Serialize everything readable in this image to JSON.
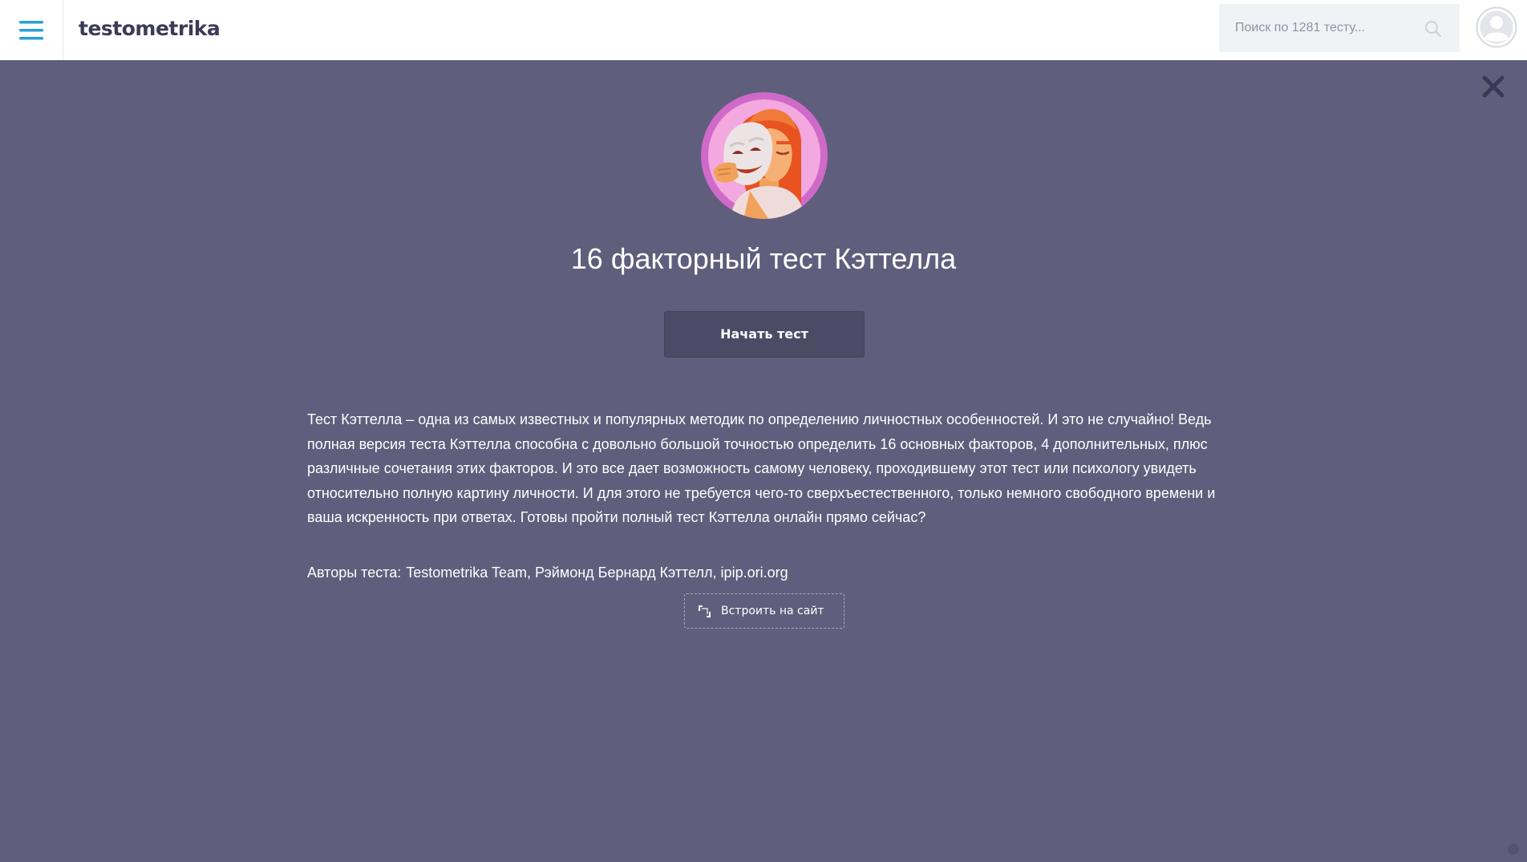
{
  "header": {
    "logo_text": "testometrika",
    "search_placeholder": "Поиск по 1281 тесту...",
    "menu_icon": "hamburger-icon",
    "avatar_icon": "user-avatar-icon"
  },
  "test": {
    "title": "16 факторный тест Кэттелла",
    "start_label": "Начать тест",
    "description": "Тест Кэттелла – одна из самых известных и популярных методик по определению личностных особенностей. И это не случайно! Ведь полная версия теста Кэттелла способна с довольно большой точностью определить 16 основных факторов, 4 дополнительных, плюс различные сочетания этих факторов. И это все дает возможность самому человеку, проходившему этот тест или психологу увидеть относительно полную картину личности. И для этого не требуется чего-то сверхъестественного, только немного свободного времени и ваша искренность при ответах. Готовы пройти полный тест Кэттелла онлайн прямо сейчас?",
    "authors_label": "Авторы теста:",
    "authors": "Testometrika Team, Рэймонд Бернард Кэттелл, ipip.ori.org",
    "embed_label": "Встроить на сайт"
  },
  "colors": {
    "background": "#5f5e7c",
    "header_bg": "#ffffff",
    "accent_blue": "#2a9fd8",
    "button_bg": "#4c4b66",
    "text_light": "#ffffff"
  }
}
